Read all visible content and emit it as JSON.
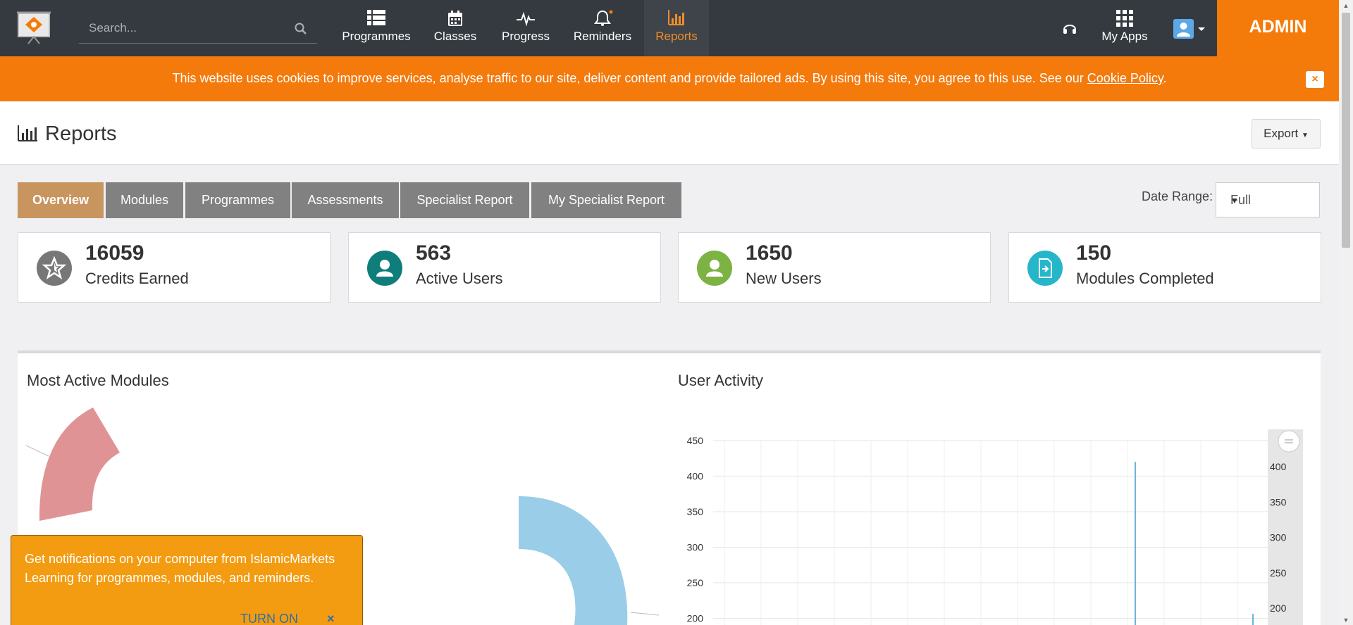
{
  "nav": {
    "search_placeholder": "Search...",
    "items": [
      {
        "label": "Programmes",
        "icon": "list-icon"
      },
      {
        "label": "Classes",
        "icon": "calendar-icon"
      },
      {
        "label": "Progress",
        "icon": "pulse-icon"
      },
      {
        "label": "Reminders",
        "icon": "bell-icon"
      },
      {
        "label": "Reports",
        "icon": "bar-chart-icon"
      }
    ],
    "my_apps": "My Apps",
    "admin": "ADMIN",
    "accent": "#f47b09",
    "active_color": "#f08c2a"
  },
  "cookie": {
    "message": "This website uses cookies to improve services, analyse traffic to our site, deliver content and provide tailored ads. By using this site, you agree to this use. See our ",
    "link": "Cookie Policy",
    "end": ".",
    "close": "×"
  },
  "page": {
    "title": "Reports",
    "export": "Export"
  },
  "tabs": [
    {
      "label": "Overview",
      "active": true
    },
    {
      "label": "Modules"
    },
    {
      "label": "Programmes"
    },
    {
      "label": "Assessments"
    },
    {
      "label": "Specialist Report"
    },
    {
      "label": "My Specialist Report"
    }
  ],
  "date_range": {
    "label": "Date Range:",
    "value": "Full"
  },
  "stats": [
    {
      "value": "16059",
      "label": "Credits Earned",
      "color": "#777777",
      "icon": "star-badge-icon"
    },
    {
      "value": "563",
      "label": "Active Users",
      "color": "#0f7e7b",
      "icon": "user-icon"
    },
    {
      "value": "1650",
      "label": "New Users",
      "color": "#7cb342",
      "icon": "user-icon"
    },
    {
      "value": "150",
      "label": "Modules Completed",
      "color": "#26b6c9",
      "icon": "document-icon"
    }
  ],
  "panels": {
    "left_title": "Most Active Modules",
    "right_title": "User Activity"
  },
  "chart_data": [
    {
      "type": "pie",
      "title": "Most Active Modules",
      "slices_visible": [
        {
          "color": "#e09394"
        },
        {
          "color": "#9acde8"
        }
      ]
    },
    {
      "type": "line",
      "title": "User Activity",
      "y_ticks": [
        200,
        250,
        300,
        350,
        400,
        450
      ],
      "ylim": [
        200,
        450
      ],
      "navigator_ticks": [
        200,
        250,
        300,
        350,
        400
      ],
      "series": [
        {
          "color": "#6ab4dc",
          "peak": 420
        }
      ]
    }
  ],
  "notification": {
    "text": "Get notifications on your computer from IslamicMarkets Learning for programmes, modules, and reminders.",
    "turn_on": "TURN ON",
    "close": "×"
  }
}
